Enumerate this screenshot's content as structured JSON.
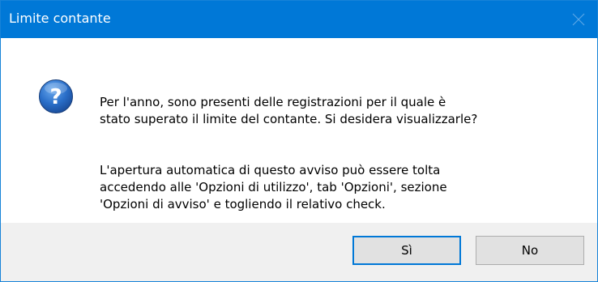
{
  "window": {
    "title": "Limite contante",
    "accent": "#0078d7"
  },
  "dialog": {
    "icon": "question-icon",
    "message_line1": "Per l'anno, sono presenti delle registrazioni per il quale è\nstato superato il limite del contante. Si desidera visualizzarle?",
    "message_line2": "L'apertura automatica di questo avviso può essere tolta\naccedendo alle 'Opzioni di utilizzo', tab 'Opzioni', sezione\n'Opzioni di avviso' e togliendo il relativo check."
  },
  "buttons": {
    "yes_label": "Sì",
    "no_label": "No"
  }
}
